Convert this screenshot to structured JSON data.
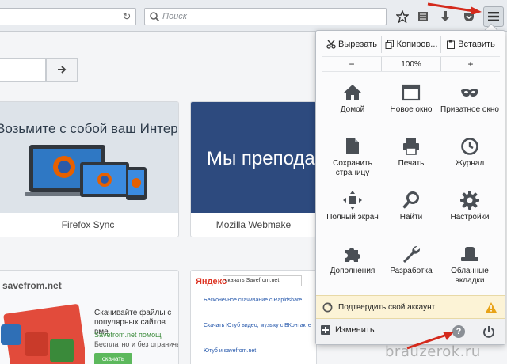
{
  "toolbar": {
    "search_placeholder": "Поиск",
    "icons": [
      "reload-icon",
      "search-icon",
      "star-icon",
      "reading-list-icon",
      "download-icon",
      "pocket-icon",
      "menu-icon"
    ]
  },
  "tiles": {
    "firefox_sync": {
      "headline": "Возьмите с собой ваш Интернет",
      "caption": "Firefox Sync"
    },
    "mozilla": {
      "headline": "Мы преподаё",
      "caption": "Mozilla Webmake"
    },
    "savefrom": {
      "logo": "savefrom.net",
      "text": "Скачивайте файлы с популярных сайтов вме",
      "link": "Savefrom.net помощ",
      "free": "Бесплатно и без ограничений!",
      "button": "скачать"
    },
    "yandex": {
      "logo": "Яндекс",
      "query": "скачать Savefrom.net",
      "results": [
        "Бесконечное скачивание с Rapidshare",
        "Скачать Ютуб видео, музыку с ВКонтакте",
        "Ютуб и savefrom.net"
      ]
    }
  },
  "menu": {
    "edit": {
      "cut": "Вырезать",
      "copy": "Копиров...",
      "paste": "Вставить"
    },
    "zoom": {
      "minus": "−",
      "level": "100%",
      "plus": "+"
    },
    "items": [
      {
        "icon": "home-icon",
        "label": "Домой"
      },
      {
        "icon": "new-window-icon",
        "label": "Новое окно"
      },
      {
        "icon": "private-window-icon",
        "label": "Приватное окно"
      },
      {
        "icon": "save-page-icon",
        "label": "Сохранить страницу"
      },
      {
        "icon": "print-icon",
        "label": "Печать"
      },
      {
        "icon": "history-icon",
        "label": "Журнал"
      },
      {
        "icon": "fullscreen-icon",
        "label": "Полный экран"
      },
      {
        "icon": "find-icon",
        "label": "Найти"
      },
      {
        "icon": "settings-icon",
        "label": "Настройки"
      },
      {
        "icon": "addons-icon",
        "label": "Дополнения"
      },
      {
        "icon": "developer-icon",
        "label": "Разработка"
      },
      {
        "icon": "cloud-tabs-icon",
        "label": "Облачные вкладки"
      }
    ],
    "sync_account": "Подтвердить свой аккаунт",
    "customize": "Изменить",
    "help_glyph": "?"
  },
  "watermark": "brauzerok.ru",
  "colors": {
    "arrow": "#d42a1c",
    "sync_bar": "#fcf3d6",
    "tile_blue": "#2d4a7e"
  }
}
